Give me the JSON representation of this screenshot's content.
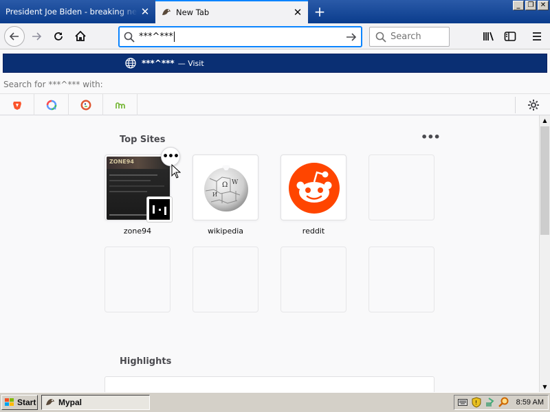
{
  "tabs": [
    {
      "title": "President Joe Biden - breaking news, v",
      "close": "✕"
    },
    {
      "title": "New Tab",
      "close": "✕"
    }
  ],
  "window_controls": [
    "_",
    "❐",
    "✕"
  ],
  "new_tab": "+",
  "urlbar": {
    "value": "***^***"
  },
  "searchbar": {
    "placeholder": "Search"
  },
  "dropdown": {
    "result_text": "***^***",
    "result_action": "— Visit",
    "search_for": "Search for ***^*** with:",
    "engine_icons": [
      "brave-icon",
      "qwant-icon",
      "duckduckgo-icon",
      "mojeek-icon"
    ]
  },
  "top_sites": {
    "title": "Top Sites",
    "more": "•••",
    "context_button": "•••",
    "tiles": [
      {
        "label": "zone94",
        "thumb_text": "ZONE94"
      },
      {
        "label": "wikipedia"
      },
      {
        "label": "reddit"
      }
    ]
  },
  "highlights": {
    "title": "Highlights"
  },
  "taskbar": {
    "start": "Start",
    "task": "Mypal",
    "clock": "8:59 AM"
  },
  "colors": {
    "accent": "#0a84ff",
    "dropdown_highlight": "#0a2f73",
    "reddit": "#ff4500"
  }
}
